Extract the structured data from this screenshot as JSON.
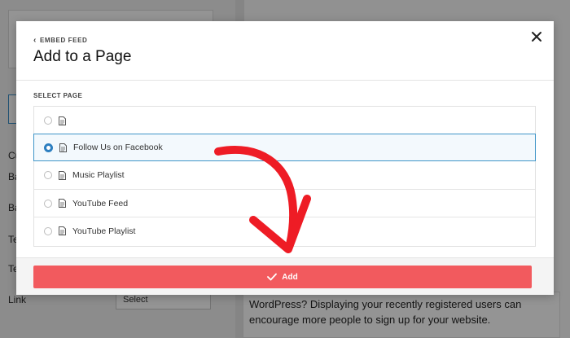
{
  "background": {
    "side_labels": [
      "Cu",
      "Ba",
      "Ba",
      "Te",
      "Te",
      "Link"
    ],
    "select_value": "Select",
    "card_text": "WordPress? Displaying your recently registered users can encourage more people to sign up for your website."
  },
  "modal": {
    "back_label": "EMBED FEED",
    "title": "Add to a Page",
    "section_label": "SELECT PAGE",
    "pages": [
      {
        "label": "",
        "selected": false
      },
      {
        "label": "Follow Us on Facebook",
        "selected": true
      },
      {
        "label": "Music Playlist",
        "selected": false
      },
      {
        "label": "YouTube Feed",
        "selected": false
      },
      {
        "label": "YouTube Playlist",
        "selected": false
      }
    ],
    "add_label": "Add"
  },
  "colors": {
    "accent_red": "#f25a5e",
    "selected_border": "#3f95c8",
    "radio_selected": "#2d7fc0",
    "annotation_arrow": "#ee1c25"
  },
  "icons": {
    "back": "chevron-left-icon",
    "close": "close-icon",
    "page": "document-icon",
    "add": "checkmark-icon"
  }
}
